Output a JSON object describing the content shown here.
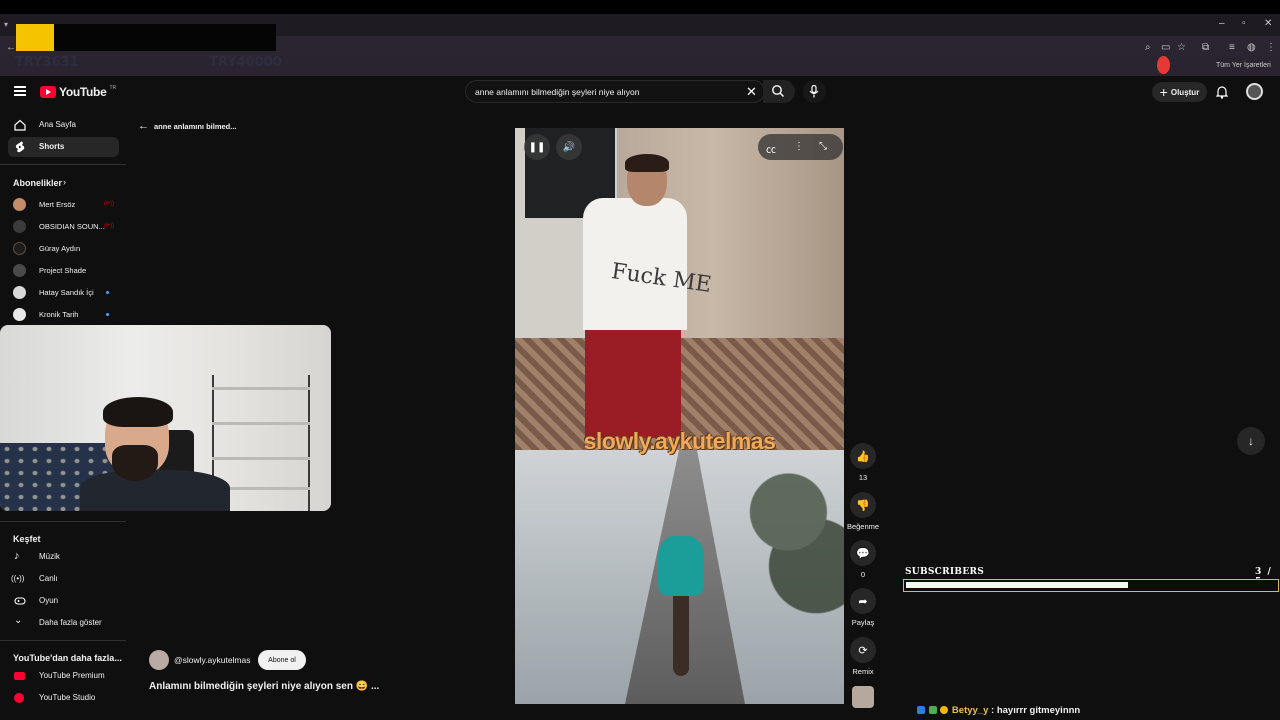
{
  "browser": {
    "overlay_labels": [
      "TRY3631",
      "TRY40000"
    ],
    "bookmarks_label": "Tüm Yer İşaretleri"
  },
  "youtube": {
    "logo_text": "YouTube",
    "region": "TR",
    "search_query": "anne anlamını bilmediğin şeyleri niye alıyon",
    "create_label": "Oluştur"
  },
  "sidebar": {
    "home": "Ana Sayfa",
    "shorts": "Shorts",
    "subscriptions_heading": "Abonelikler",
    "subscriptions": [
      {
        "name": "Mert Ersöz",
        "live": true
      },
      {
        "name": "OBSIDIAN SOUN...",
        "live": true
      },
      {
        "name": "Güray Aydın",
        "live": false
      },
      {
        "name": "Project Shade",
        "live": false
      },
      {
        "name": "Hatay Sandık İçi",
        "new": true
      },
      {
        "name": "Kronik Tarih",
        "new": true
      }
    ],
    "explore_heading": "Keşfet",
    "explore": [
      "Müzik",
      "Canlı",
      "Oyun",
      "Daha fazla göster"
    ],
    "more_heading": "YouTube'dan daha fazla...",
    "more": [
      "YouTube Premium",
      "YouTube Studio"
    ]
  },
  "shorts": {
    "back_text": "anne anlamını bilmed...",
    "video_shirt_text": "Fuck ME",
    "watermark": "slowly.aykutelmas",
    "channel": "@slowly.aykutelmas",
    "subscribe_label": "Abone ol",
    "title": "Anlamını bilmediğin şeyleri niye alıyon sen 😄 ...",
    "actions": {
      "like_count": "13",
      "dislike_label": "Beğenme",
      "comment_count": "0",
      "share_label": "Paylaş",
      "remix_label": "Remix"
    }
  },
  "overlay": {
    "subs_label": "SUBSCRIBERS",
    "subs_count": "3",
    "subs_goal": "/ 5",
    "subs_progress": 0.6,
    "chat_user": "Betyy_y",
    "chat_message": ": hayırrr gitmeyinnn"
  },
  "colors": {
    "yt_red": "#ff0033",
    "bar_border": "#d9b85a",
    "watermark": "#f3a85a"
  }
}
